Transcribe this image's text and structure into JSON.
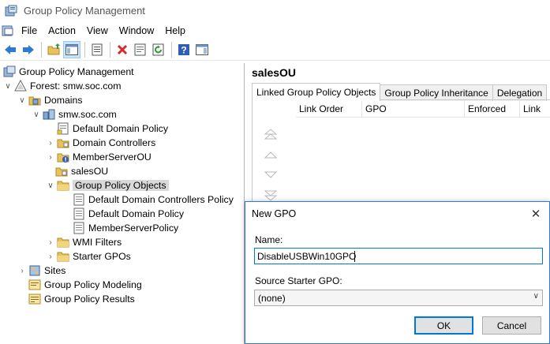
{
  "window": {
    "title": "Group Policy Management"
  },
  "menubar": {
    "items": [
      "File",
      "Action",
      "View",
      "Window",
      "Help"
    ]
  },
  "toolbar": {
    "buttons": [
      "back-icon",
      "forward-icon",
      "up-folder-icon",
      "show-hide-tree-icon",
      "copy-icon",
      "delete-icon",
      "properties-icon",
      "refresh-icon",
      "help-icon",
      "action-pane-icon"
    ]
  },
  "tree": {
    "items": [
      {
        "label": "Group Policy Management",
        "icon": "gpm-icon"
      },
      {
        "label": "Forest: smw.soc.com",
        "icon": "forest-icon"
      },
      {
        "label": "Domains",
        "icon": "domains-icon"
      },
      {
        "label": "smw.soc.com",
        "icon": "domain-icon"
      },
      {
        "label": "Default Domain Policy",
        "icon": "gpo-link-icon"
      },
      {
        "label": "Domain Controllers",
        "icon": "ou-icon"
      },
      {
        "label": "MemberServerOU",
        "icon": "ou-warning-icon"
      },
      {
        "label": "salesOU",
        "icon": "ou-icon"
      },
      {
        "label": "Group Policy Objects",
        "icon": "folder-icon"
      },
      {
        "label": "Default Domain Controllers Policy",
        "icon": "gpo-icon"
      },
      {
        "label": "Default Domain Policy",
        "icon": "gpo-icon"
      },
      {
        "label": "MemberServerPolicy",
        "icon": "gpo-icon"
      },
      {
        "label": "WMI Filters",
        "icon": "folder-icon"
      },
      {
        "label": "Starter GPOs",
        "icon": "folder-icon"
      },
      {
        "label": "Sites",
        "icon": "sites-icon"
      },
      {
        "label": "Group Policy Modeling",
        "icon": "modeling-icon"
      },
      {
        "label": "Group Policy Results",
        "icon": "results-icon"
      }
    ]
  },
  "details": {
    "heading": "salesOU",
    "tabs": [
      "Linked Group Policy Objects",
      "Group Policy Inheritance",
      "Delegation"
    ],
    "columns": [
      "Link Order",
      "GPO",
      "Enforced",
      "Link"
    ]
  },
  "dialog": {
    "title": "New GPO",
    "name_label": "Name:",
    "name_value": "DisableUSBWin10GPO",
    "source_label": "Source Starter GPO:",
    "source_value": "(none)",
    "ok_label": "OK",
    "cancel_label": "Cancel"
  },
  "colors": {
    "accent": "#0078d7",
    "folder": "#e8c25a",
    "selected_bg": "#d9d9d9"
  }
}
